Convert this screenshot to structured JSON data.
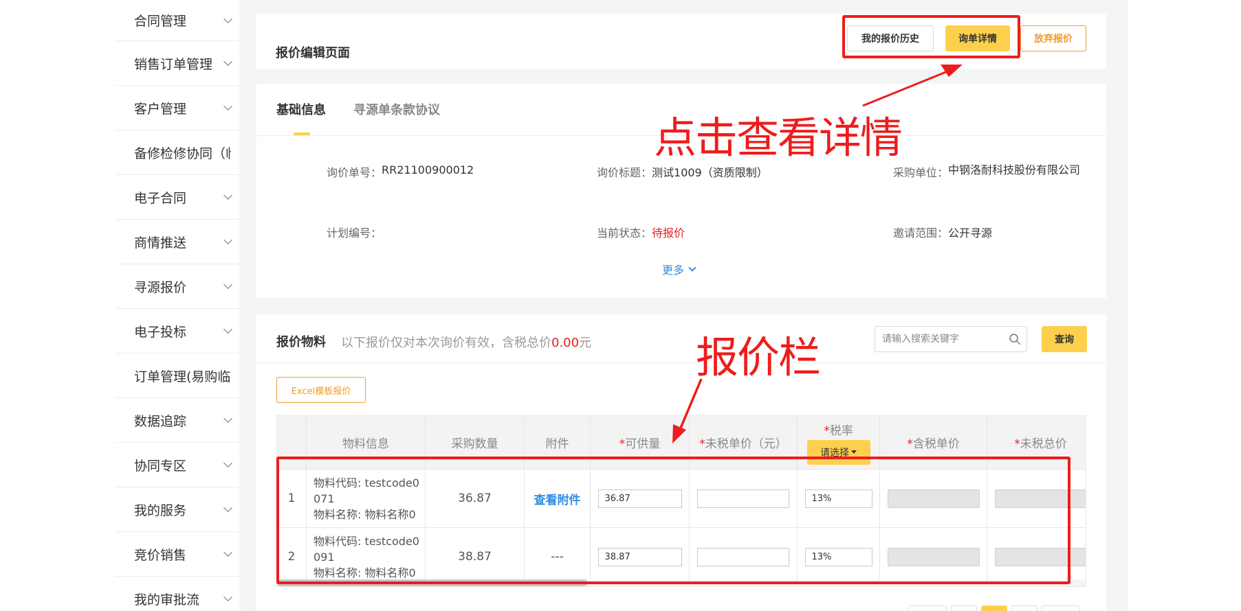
{
  "sidebar": {
    "items": [
      {
        "label": "合同管理"
      },
      {
        "label": "销售订单管理"
      },
      {
        "label": "客户管理"
      },
      {
        "label": "备修检修协同（临"
      },
      {
        "label": "电子合同"
      },
      {
        "label": "商情推送"
      },
      {
        "label": "寻源报价"
      },
      {
        "label": "电子投标"
      },
      {
        "label": "订单管理(易购临时"
      },
      {
        "label": "数据追踪"
      },
      {
        "label": "协同专区"
      },
      {
        "label": "我的服务"
      },
      {
        "label": "竞价销售"
      },
      {
        "label": "我的审批流"
      }
    ]
  },
  "header": {
    "title": "报价编辑页面",
    "history_button": "我的报价历史",
    "detail_button": "询单详情",
    "abandon_button": "放弃报价"
  },
  "info": {
    "tabs": {
      "basic": "基础信息",
      "terms": "寻源单条款协议"
    },
    "inquiry_no_label": "询价单号：",
    "inquiry_no_value": "RR21100900012",
    "inquiry_title_label": "询价标题：",
    "inquiry_title_value": "测试1009（资质限制）",
    "purchaser_label": "采购单位：",
    "purchaser_value": "中钢洛耐科技股份有限公司",
    "plan_no_label": "计划编号：",
    "plan_no_value": "",
    "status_label": "当前状态：",
    "status_value": "待报价",
    "scope_label": "邀请范围：",
    "scope_value": "公开寻源",
    "more_link": "更多"
  },
  "materials": {
    "title": "报价物料",
    "note_prefix": "以下报价仅对本次询价有效，含税总价",
    "note_total": "0.00",
    "note_suffix": "元",
    "search_placeholder": "请输入搜索关键字",
    "query_button": "查询",
    "excel_button": "Excel模板报价",
    "columns": {
      "material_info": "物料信息",
      "purchase_qty": "采购数量",
      "attachment": "附件",
      "supply_qty": "可供量",
      "untaxed_price": "未税单价（元）",
      "tax_rate": "税率",
      "tax_rate_select": "请选择",
      "taxed_price": "含税单价",
      "untaxed_total": "未税总价"
    },
    "rows": [
      {
        "index": "1",
        "code_line1": "物料代码: testcode0",
        "code_line2": "071",
        "name_line": "物料名称: 物料名称0",
        "qty": "36.87",
        "attachment": "查看附件",
        "supply": "36.87",
        "untaxed_price": "",
        "tax_rate": "13%"
      },
      {
        "index": "2",
        "code_line1": "物料代码: testcode0",
        "code_line2": "091",
        "name_line": "物料名称: 物料名称0",
        "qty": "38.87",
        "attachment": "---",
        "supply": "38.87",
        "untaxed_price": "",
        "tax_rate": "13%"
      }
    ]
  },
  "annotations": {
    "detail_hint": "点击查看详情",
    "quote_hint": "报价栏"
  },
  "colors": {
    "accent": "#fcd04c",
    "orange": "#f29b2b",
    "red": "#e02020",
    "link": "#2f8de4",
    "annotation": "#ee1c1c"
  }
}
